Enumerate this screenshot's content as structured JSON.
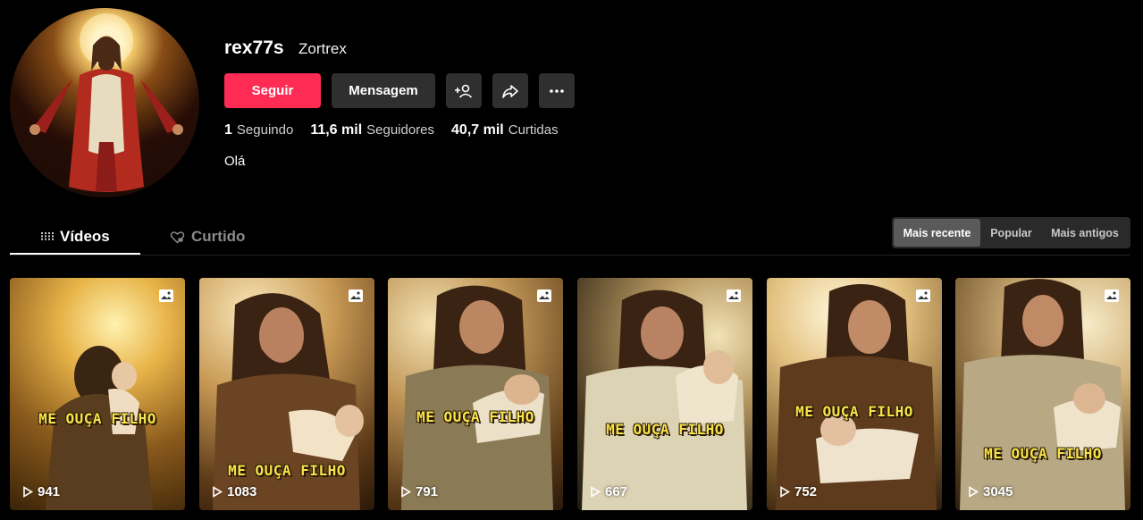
{
  "profile": {
    "username": "rex77s",
    "nickname": "Zortrex",
    "follow_label": "Seguir",
    "message_label": "Mensagem",
    "stats": [
      {
        "value": "1",
        "label": "Seguindo"
      },
      {
        "value": "11,6 mil",
        "label": "Seguidores"
      },
      {
        "value": "40,7 mil",
        "label": "Curtidas"
      }
    ],
    "bio": "Olá",
    "icons": {
      "add_friend": "add-friend-icon",
      "share": "share-icon",
      "more": "more-icon"
    }
  },
  "tabs": {
    "videos": "Vídeos",
    "liked": "Curtido"
  },
  "sort": {
    "options": [
      "Mais recente",
      "Popular",
      "Mais antigos"
    ],
    "selected": "Mais recente"
  },
  "videos": [
    {
      "caption": "ME OUÇA FILHO",
      "views": "941"
    },
    {
      "caption": "ME OUÇA FILHO",
      "views": "1083"
    },
    {
      "caption": "ME OUÇA FILHO",
      "views": "791"
    },
    {
      "caption": "ME OUÇA FILHO",
      "views": "667"
    },
    {
      "caption": "ME OUÇA FILHO",
      "views": "752"
    },
    {
      "caption": "ME OUÇA FILHO",
      "views": "3045"
    }
  ],
  "colors": {
    "accent": "#fe2c55",
    "background": "#000000",
    "button": "#2f2f2f",
    "caption": "#f7e34a"
  }
}
